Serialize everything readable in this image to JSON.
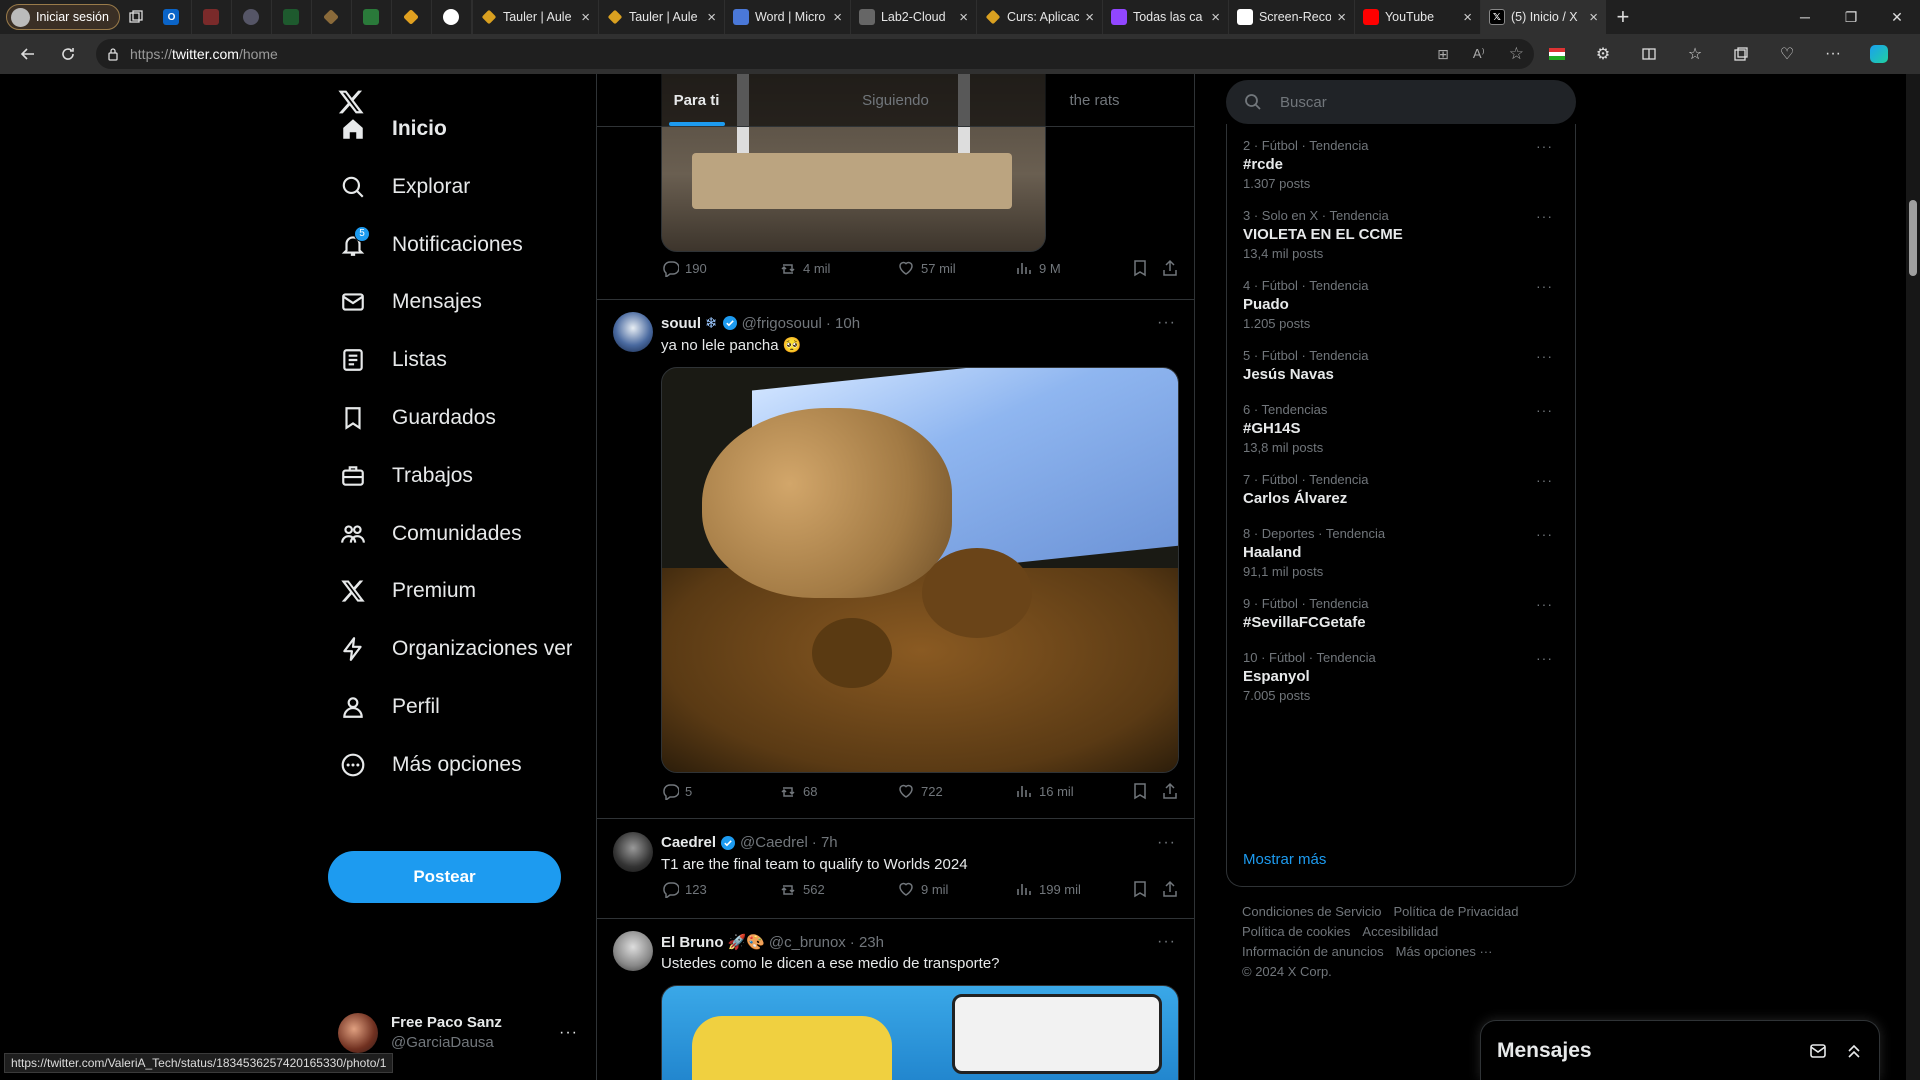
{
  "browser": {
    "signin_label": "Iniciar sesión",
    "tabs": [
      {
        "label": "Tauler | Aule",
        "icon": "moodle-icon"
      },
      {
        "label": "Tauler | Aule",
        "icon": "moodle-icon"
      },
      {
        "label": "Word | Micro",
        "icon": "word-icon"
      },
      {
        "label": "Lab2-Cloud",
        "icon": "document-icon"
      },
      {
        "label": "Curs: Aplicac",
        "icon": "moodle-icon"
      },
      {
        "label": "Todas las ca",
        "icon": "twitch-icon"
      },
      {
        "label": "Screen-Reco",
        "icon": "github-icon"
      },
      {
        "label": "YouTube",
        "icon": "youtube-icon"
      },
      {
        "label": "(5) Inicio / X",
        "icon": "x-icon"
      }
    ],
    "url_scheme": "https://",
    "url_host": "twitter.com",
    "url_path": "/home",
    "status_url": "https://twitter.com/ValeriA_Tech/status/1834536257420165330/photo/1"
  },
  "nav": {
    "items": [
      {
        "label": "Inicio",
        "icon": "home-icon"
      },
      {
        "label": "Explorar",
        "icon": "search-icon"
      },
      {
        "label": "Notificaciones",
        "icon": "bell-icon",
        "badge": "5"
      },
      {
        "label": "Mensajes",
        "icon": "mail-icon"
      },
      {
        "label": "Listas",
        "icon": "list-icon"
      },
      {
        "label": "Guardados",
        "icon": "bookmark-icon"
      },
      {
        "label": "Trabajos",
        "icon": "briefcase-icon"
      },
      {
        "label": "Comunidades",
        "icon": "people-icon"
      },
      {
        "label": "Premium",
        "icon": "x-icon"
      },
      {
        "label": "Organizaciones ver",
        "icon": "lightning-icon"
      },
      {
        "label": "Perfil",
        "icon": "user-icon"
      },
      {
        "label": "Más opciones",
        "icon": "more-circle-icon"
      }
    ],
    "post_label": "Postear",
    "account": {
      "name": "Free Paco Sanz",
      "handle": "@GarciaDausa"
    }
  },
  "feed": {
    "tabs": [
      "Para ti",
      "Siguiendo",
      "the rats"
    ],
    "active_tab": "Para ti",
    "first_actions": {
      "replies": "190",
      "reposts": "4 mil",
      "likes": "57 mil",
      "views": "9 M"
    },
    "tweets": [
      {
        "name": "souul",
        "handle": "@frigosouul",
        "time": "· 10h",
        "text": "ya no lele pancha 🥺",
        "replies": "5",
        "reposts": "68",
        "likes": "722",
        "views": "16 mil"
      },
      {
        "name": "Caedrel",
        "handle": "@Caedrel",
        "time": "· 7h",
        "text": "T1 are the final team to qualify to Worlds 2024",
        "replies": "123",
        "reposts": "562",
        "likes": "9 mil",
        "views": "199 mil"
      },
      {
        "name": "El Bruno",
        "handle": "@c_brunox",
        "time": "· 23h",
        "text": "Ustedes como le dicen a ese medio de transporte?"
      }
    ]
  },
  "sidebar": {
    "search_placeholder": "Buscar",
    "trends": [
      {
        "meta": "2 · Fútbol · Tendencia",
        "name": "#rcde",
        "count": "1.307 posts"
      },
      {
        "meta": "3 · Solo en X · Tendencia",
        "name": "VIOLETA EN EL CCME",
        "count": "13,4 mil posts"
      },
      {
        "meta": "4 · Fútbol · Tendencia",
        "name": "Puado",
        "count": "1.205 posts"
      },
      {
        "meta": "5 · Fútbol · Tendencia",
        "name": "Jesús Navas",
        "count": ""
      },
      {
        "meta": "6 · Tendencias",
        "name": "#GH14S",
        "count": "13,8 mil posts"
      },
      {
        "meta": "7 · Fútbol · Tendencia",
        "name": "Carlos Álvarez",
        "count": ""
      },
      {
        "meta": "8 · Deportes · Tendencia",
        "name": "Haaland",
        "count": "91,1 mil posts"
      },
      {
        "meta": "9 · Fútbol · Tendencia",
        "name": "#SevillaFCGetafe",
        "count": ""
      },
      {
        "meta": "10 · Fútbol · Tendencia",
        "name": "Espanyol",
        "count": "7.005 posts"
      }
    ],
    "show_more": "Mostrar más",
    "footer_links": [
      "Condiciones de Servicio",
      "Política de Privacidad",
      "Política de cookies",
      "Accesibilidad",
      "Información de anuncios",
      "Más opciones ···"
    ],
    "copyright": "© 2024 X Corp.",
    "messages_title": "Mensajes"
  }
}
